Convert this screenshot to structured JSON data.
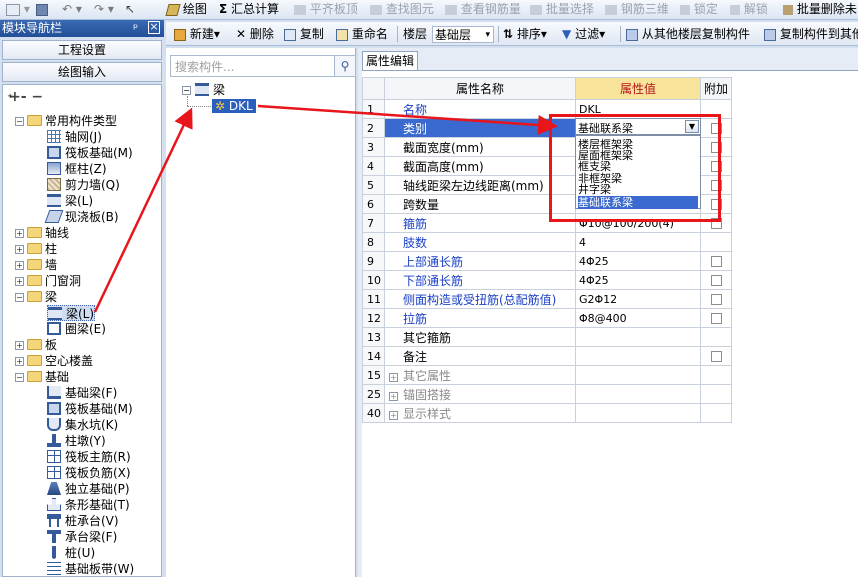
{
  "toolbar": {
    "items": [
      "绘图",
      "汇总计算",
      "平齐板顶",
      "查找图元",
      "查看钢筋量",
      "批量选择",
      "钢筋三维",
      "锁定",
      "解锁",
      "批量删除未"
    ]
  },
  "nav": {
    "title": "模块导航栏",
    "pin": "ᵖ",
    "close": "×",
    "buttons": [
      "工程设置",
      "绘图输入"
    ],
    "tree": [
      {
        "label": "常用构件类型"
      },
      {
        "label": "轴网(J)"
      },
      {
        "label": "筏板基础(M)"
      },
      {
        "label": "框柱(Z)"
      },
      {
        "label": "剪力墙(Q)"
      },
      {
        "label": "梁(L)"
      },
      {
        "label": "现浇板(B)"
      },
      {
        "label": "轴线"
      },
      {
        "label": "柱"
      },
      {
        "label": "墙"
      },
      {
        "label": "门窗洞"
      },
      {
        "label": "梁"
      },
      {
        "label": "梁(L)"
      },
      {
        "label": "圈梁(E)"
      },
      {
        "label": "板"
      },
      {
        "label": "空心楼盖"
      },
      {
        "label": "基础"
      },
      {
        "label": "基础梁(F)"
      },
      {
        "label": "筏板基础(M)"
      },
      {
        "label": "集水坑(K)"
      },
      {
        "label": "柱墩(Y)"
      },
      {
        "label": "筏板主筋(R)"
      },
      {
        "label": "筏板负筋(X)"
      },
      {
        "label": "独立基础(P)"
      },
      {
        "label": "条形基础(T)"
      },
      {
        "label": "桩承台(V)"
      },
      {
        "label": "承台梁(F)"
      },
      {
        "label": "桩(U)"
      },
      {
        "label": "基础板带(W)"
      }
    ]
  },
  "toolbar2": {
    "new": "新建",
    "delete": "删除",
    "copy": "复制",
    "rename": "重命名",
    "floor_label": "楼层",
    "floor_value": "基础层",
    "sort": "排序",
    "filter": "过滤",
    "copy_from_other": "从其他楼层复制构件",
    "copy_to_other": "复制构件到其他"
  },
  "middle": {
    "search_placeholder": "搜索构件...",
    "root": "梁",
    "child": "DKL"
  },
  "props": {
    "tab": "属性编辑",
    "headers": {
      "name": "属性名称",
      "value": "属性值",
      "add": "附加"
    },
    "rows": [
      {
        "num": "1",
        "name": "名称",
        "value": "DKL",
        "style": "blue",
        "check": false
      },
      {
        "num": "2",
        "name": "类别",
        "value": "基础联系梁",
        "style": "blue",
        "check": true
      },
      {
        "num": "3",
        "name": "截面宽度(mm)",
        "value": "",
        "style": "",
        "check": true
      },
      {
        "num": "4",
        "name": "截面高度(mm)",
        "value": "",
        "style": "",
        "check": true
      },
      {
        "num": "5",
        "name": "轴线距梁左边线距离(mm)",
        "value": "",
        "style": "",
        "check": true
      },
      {
        "num": "6",
        "name": "跨数量",
        "value": "",
        "style": "",
        "check": true
      },
      {
        "num": "7",
        "name": "箍筋",
        "value": "Φ10@100/200(4)",
        "style": "blue",
        "check": true
      },
      {
        "num": "8",
        "name": "肢数",
        "value": "4",
        "style": "blue",
        "check": false
      },
      {
        "num": "9",
        "name": "上部通长筋",
        "value": "4Φ25",
        "style": "blue",
        "check": true
      },
      {
        "num": "10",
        "name": "下部通长筋",
        "value": "4Φ25",
        "style": "blue",
        "check": true
      },
      {
        "num": "11",
        "name": "侧面构造或受扭筋(总配筋值)",
        "value": "G2Φ12",
        "style": "blue",
        "check": true
      },
      {
        "num": "12",
        "name": "拉筋",
        "value": "Φ8@400",
        "style": "blue",
        "check": true
      },
      {
        "num": "13",
        "name": "其它箍筋",
        "value": "",
        "style": "",
        "check": false
      },
      {
        "num": "14",
        "name": "备注",
        "value": "",
        "style": "",
        "check": true
      },
      {
        "num": "15",
        "name": "其它属性",
        "value": "",
        "style": "gray",
        "check": false,
        "group": true
      },
      {
        "num": "25",
        "name": "锚固搭接",
        "value": "",
        "style": "gray",
        "check": false,
        "group": true
      },
      {
        "num": "40",
        "name": "显示样式",
        "value": "",
        "style": "gray",
        "check": false,
        "group": true
      }
    ]
  },
  "dropdown": {
    "selected": "基础联系梁",
    "options": [
      "楼层框架梁",
      "屋面框架梁",
      "框支梁",
      "非框架梁",
      "井字梁",
      "基础联系梁"
    ]
  },
  "colors": {
    "accent": "#2a5fbd",
    "annotation": "#e8151b",
    "value_header": "#f7e39a"
  }
}
